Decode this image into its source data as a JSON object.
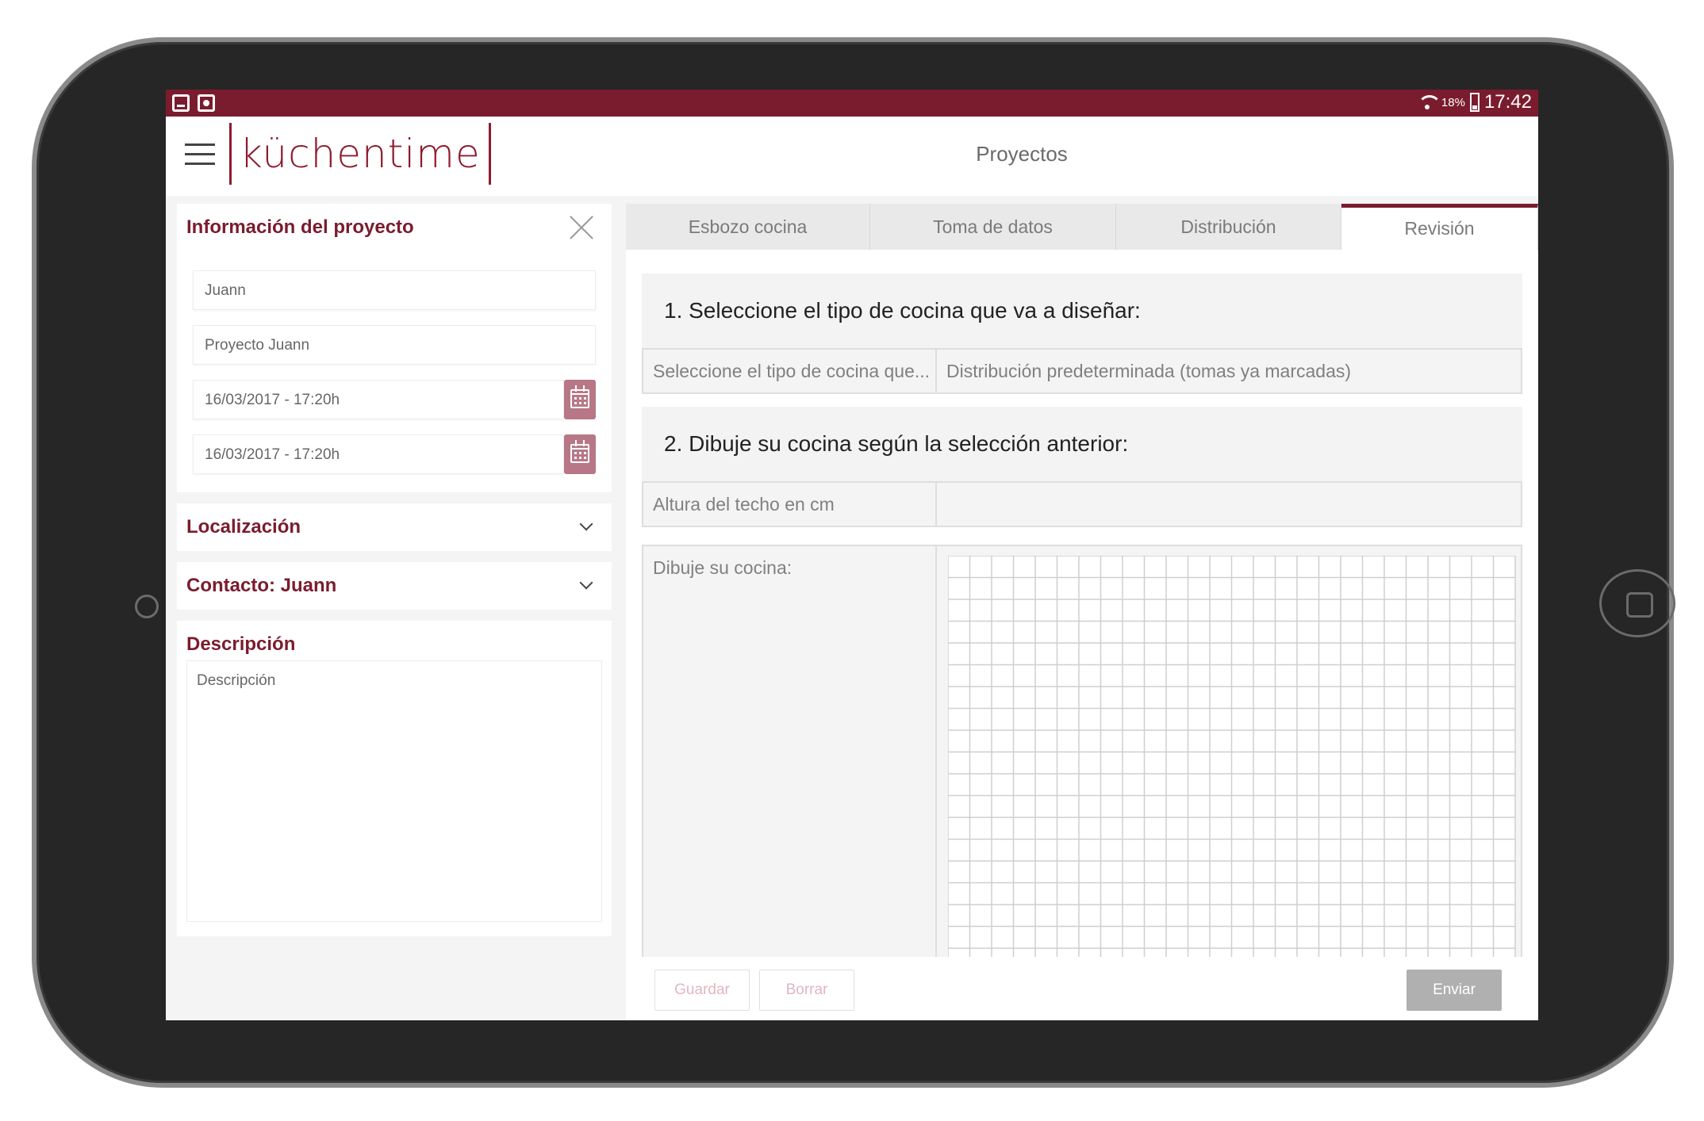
{
  "status_bar": {
    "battery_percent": "18%",
    "time": "17:42"
  },
  "app_bar": {
    "logo_text": "küchentime",
    "title": "Proyectos"
  },
  "left_panel": {
    "project_info": {
      "title": "Información del proyecto",
      "fields": {
        "client": "Juann",
        "project_name": "Proyecto Juann",
        "start_date": "16/03/2017 - 17:20h",
        "end_date": "16/03/2017 - 17:20h"
      }
    },
    "location": {
      "title": "Localización"
    },
    "contact": {
      "title": "Contacto: Juann"
    },
    "description": {
      "title": "Descripción",
      "placeholder": "Descripción"
    }
  },
  "tabs": [
    {
      "label": "Esbozo cocina",
      "active": false
    },
    {
      "label": "Toma de datos",
      "active": false
    },
    {
      "label": "Distribución",
      "active": false
    },
    {
      "label": "Revisión",
      "active": true
    }
  ],
  "main": {
    "step1": {
      "heading": "1. Seleccione el tipo de cocina que va a diseñar:",
      "label": "Seleccione el tipo de cocina que...",
      "value": "Distribución predeterminada (tomas ya marcadas)"
    },
    "step2": {
      "heading": "2. Dibuje su cocina según la selección anterior:",
      "ceiling_label": "Altura del techo en cm",
      "ceiling_value": "",
      "draw_label": "Dibuje su cocina:"
    },
    "buttons": {
      "save": "Guardar",
      "clear": "Borrar",
      "send": "Enviar"
    }
  },
  "colors": {
    "brand": "#7a1c2e",
    "calendar_button": "#b77786"
  }
}
